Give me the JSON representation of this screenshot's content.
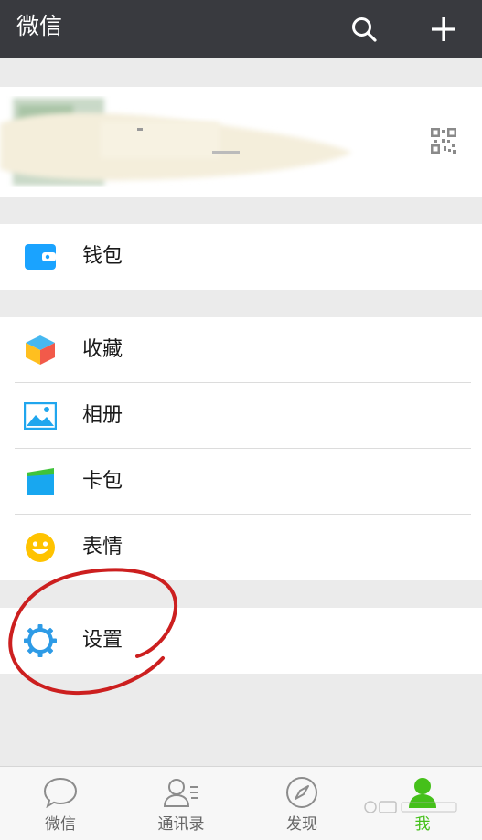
{
  "header": {
    "title": "微信",
    "search_icon": "search-icon",
    "add_icon": "plus-icon"
  },
  "profile": {
    "avatar": "blurred-avatar",
    "qr_icon": "qr-code-icon"
  },
  "menu": {
    "wallet": {
      "label": "钱包",
      "icon": "wallet-icon",
      "color": "#1aa3ff"
    },
    "favorites": {
      "label": "收藏",
      "icon": "cube-icon"
    },
    "album": {
      "label": "相册",
      "icon": "picture-icon",
      "color": "#20a6ee"
    },
    "cards": {
      "label": "卡包",
      "icon": "card-pack-icon"
    },
    "stickers": {
      "label": "表情",
      "icon": "smiley-icon",
      "color": "#ffc300"
    },
    "settings": {
      "label": "设置",
      "icon": "gear-icon",
      "color": "#2e9be6"
    }
  },
  "tabs": [
    {
      "label": "微信",
      "icon": "chat-bubble-icon"
    },
    {
      "label": "通讯录",
      "icon": "contacts-icon"
    },
    {
      "label": "发现",
      "icon": "compass-icon"
    },
    {
      "label": "我",
      "icon": "person-icon",
      "active": true
    }
  ],
  "colors": {
    "topbar": "#393a3f",
    "active_tab": "#45c01a",
    "annotation": "#cc1f1f"
  }
}
